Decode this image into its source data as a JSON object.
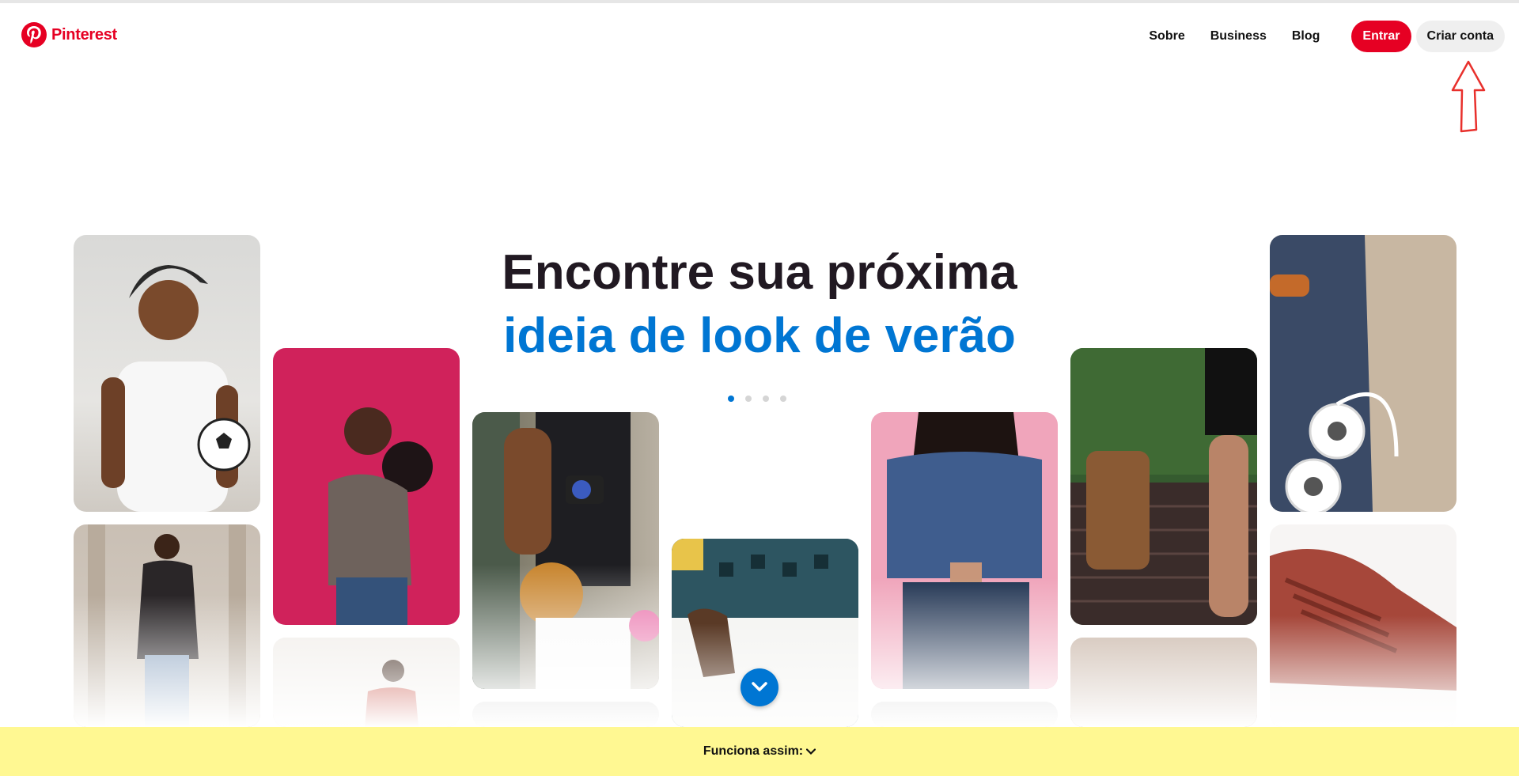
{
  "brand": {
    "name": "Pinterest",
    "color": "#e60023"
  },
  "nav": {
    "links": [
      "Sobre",
      "Business",
      "Blog"
    ],
    "login_label": "Entrar",
    "signup_label": "Criar conta"
  },
  "hero": {
    "line1": "Encontre sua próxima",
    "line2": "ideia de look de verão",
    "accent_color": "#0076d3",
    "carousel_dots": 4,
    "active_dot": 0
  },
  "icons": {
    "logo": "pinterest-logo-icon",
    "annotation": "red-up-arrow-annotation",
    "scroll": "chevron-down-icon"
  },
  "pins": [
    "man-cap-soccer-ball-photo",
    "woman-buns-pink-wall-photo",
    "woman-camera-rattan-bag-photo",
    "hands-envelope-patterned-shirt-photo",
    "woman-denim-shirt-pink-wall-photo",
    "leather-backpack-brick-wall-photo",
    "headphones-denim-wood-photo",
    "woman-dark-outfit-columns-photo",
    "red-sneakers-photo"
  ],
  "footer": {
    "label": "Funciona assim:",
    "background": "#fff892"
  }
}
